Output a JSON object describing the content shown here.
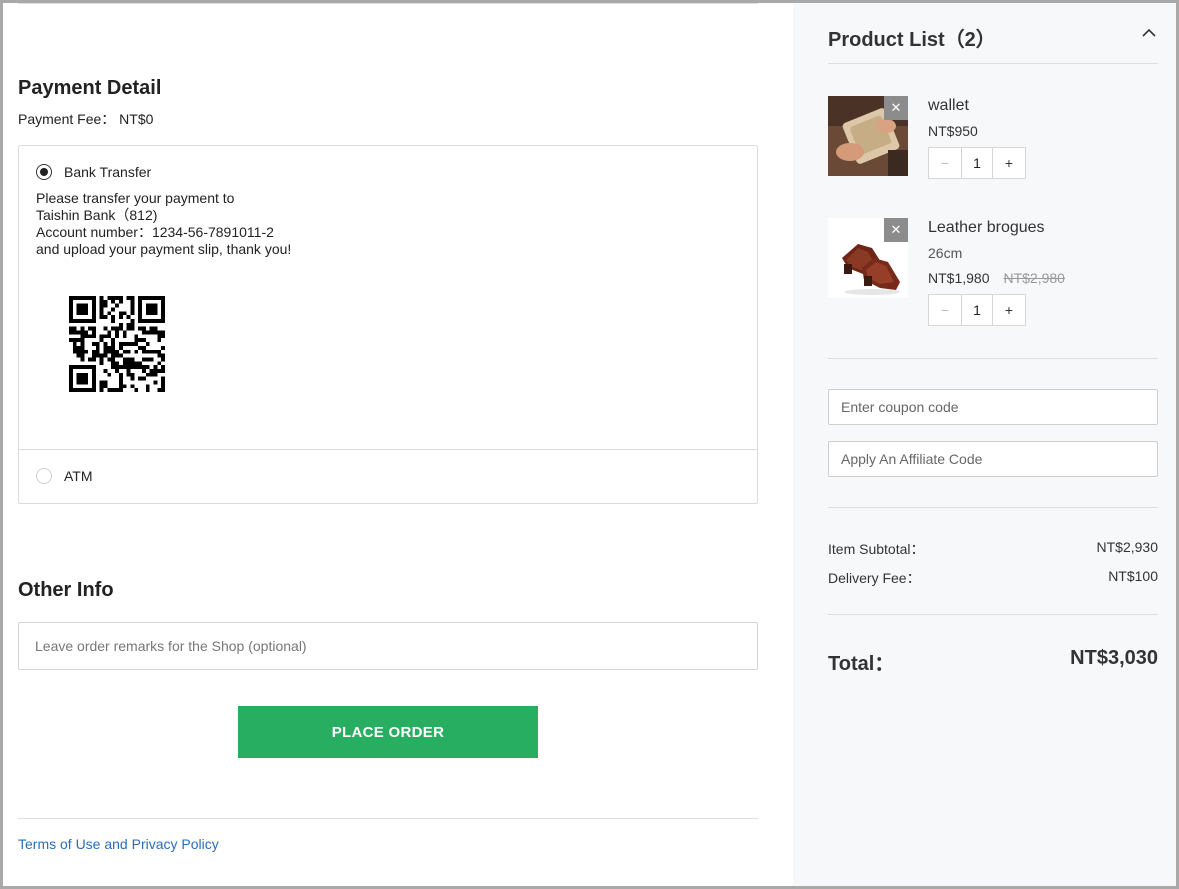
{
  "payment": {
    "heading": "Payment Detail",
    "fee_label": "Payment Fee：",
    "fee_value": "NT$0",
    "options": [
      {
        "label": "Bank Transfer",
        "selected": true
      },
      {
        "label": "ATM",
        "selected": false
      }
    ],
    "instructions": [
      "Please transfer your payment to",
      "Taishin Bank（812)",
      "Account number：1234-56-7891011-2",
      "and upload your payment slip, thank you!"
    ]
  },
  "other_info": {
    "heading": "Other Info",
    "remarks_placeholder": "Leave order remarks for the Shop (optional)"
  },
  "actions": {
    "place_order": "PLACE ORDER",
    "terms_link": "Terms of Use and Privacy Policy"
  },
  "cart": {
    "title": "Product List（2）",
    "items": [
      {
        "name": "wallet",
        "variant": "",
        "price": "NT$950",
        "original_price": "",
        "qty": "1"
      },
      {
        "name": "Leather brogues",
        "variant": "26cm",
        "price": "NT$1,980",
        "original_price": "NT$2,980",
        "qty": "1"
      }
    ],
    "coupon_placeholder": "Enter coupon code",
    "affiliate_placeholder": "Apply An Affiliate Code",
    "subtotal_label": "Item Subtotal：",
    "subtotal_value": "NT$2,930",
    "delivery_label": "Delivery Fee：",
    "delivery_value": "NT$100",
    "total_label": "Total：",
    "total_value": "NT$3,030"
  },
  "colors": {
    "accent_green": "#27ae60",
    "link_blue": "#2a6ebb",
    "sidebar_bg": "#f7f8fa"
  },
  "icons": {
    "collapse": "chevron-up-icon",
    "remove": "close-icon",
    "minus": "minus-icon",
    "plus": "plus-icon"
  }
}
